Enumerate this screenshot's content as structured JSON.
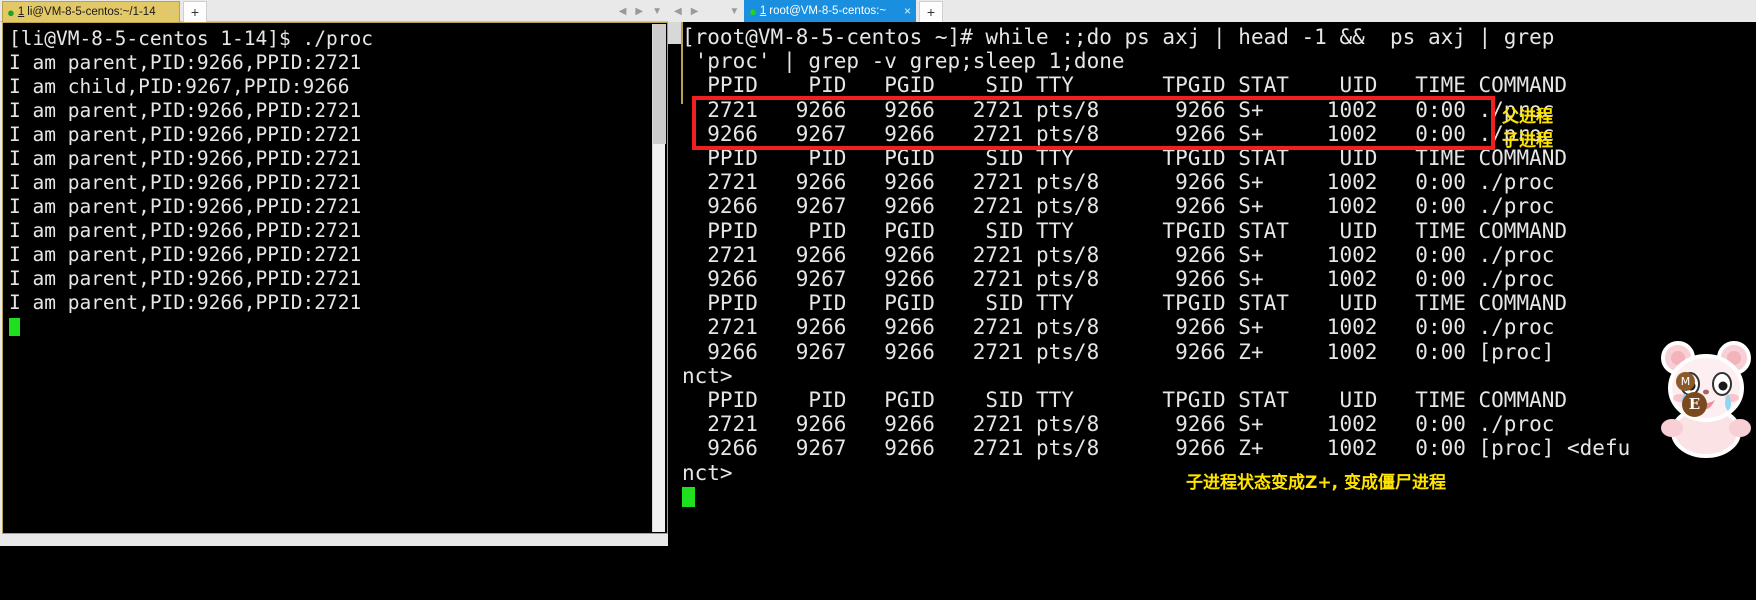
{
  "left_window": {
    "tab": {
      "index": "1",
      "title": "li@VM-8-5-centos:~/1-14",
      "close_label": "×",
      "new_tab_label": "+",
      "status_dot_color": "#21a121"
    },
    "nav": {
      "prev": "◀",
      "next": "▶",
      "menu": "▼"
    },
    "terminal": {
      "lines": [
        "[li@VM-8-5-centos 1-14]$ ./proc",
        "I am parent,PID:9266,PPID:2721",
        "I am child,PID:9267,PPID:9266",
        "I am parent,PID:9266,PPID:2721",
        "I am parent,PID:9266,PPID:2721",
        "I am parent,PID:9266,PPID:2721",
        "I am parent,PID:9266,PPID:2721",
        "I am parent,PID:9266,PPID:2721",
        "I am parent,PID:9266,PPID:2721",
        "I am parent,PID:9266,PPID:2721",
        "I am parent,PID:9266,PPID:2721",
        "I am parent,PID:9266,PPID:2721"
      ]
    }
  },
  "right_window": {
    "tab": {
      "index": "1",
      "title": "root@VM-8-5-centos:~",
      "close_label": "×",
      "new_tab_label": "+",
      "status_dot_color": "#23d423"
    },
    "nav": {
      "prev": "◀",
      "next": "▶",
      "menu": "▼"
    },
    "terminal": {
      "lines": [
        "[root@VM-8-5-centos ~]# while :;do ps axj | head -1 &&  ps axj | grep",
        " 'proc' | grep -v grep;sleep 1;done",
        "  PPID    PID   PGID    SID TTY       TPGID STAT    UID   TIME COMMAND",
        "  2721   9266   9266   2721 pts/8      9266 S+     1002   0:00 ./proc",
        "  9266   9267   9266   2721 pts/8      9266 S+     1002   0:00 ./proc",
        "  PPID    PID   PGID    SID TTY       TPGID STAT    UID   TIME COMMAND",
        "  2721   9266   9266   2721 pts/8      9266 S+     1002   0:00 ./proc",
        "  9266   9267   9266   2721 pts/8      9266 S+     1002   0:00 ./proc",
        "  PPID    PID   PGID    SID TTY       TPGID STAT    UID   TIME COMMAND",
        "  2721   9266   9266   2721 pts/8      9266 S+     1002   0:00 ./proc",
        "  9266   9267   9266   2721 pts/8      9266 S+     1002   0:00 ./proc",
        "  PPID    PID   PGID    SID TTY       TPGID STAT    UID   TIME COMMAND",
        "  2721   9266   9266   2721 pts/8      9266 S+     1002   0:00 ./proc",
        "  9266   9267   9266   2721 pts/8      9266 Z+     1002   0:00 [proc]",
        "nct>",
        "  PPID    PID   PGID    SID TTY       TPGID STAT    UID   TIME COMMAND",
        "  2721   9266   9266   2721 pts/8      9266 S+     1002   0:00 ./proc",
        "  9266   9267   9266   2721 pts/8      9266 Z+     1002   0:00 [proc] <defu",
        "nct>"
      ]
    }
  },
  "annotations": {
    "parent_process": "父进程",
    "child_process": "子进程",
    "zombie_note": "子进程状态变成Z+, 变成僵尸进程",
    "highlight_color": "#f02020",
    "annotation_color": "#ffe400"
  },
  "sticker": {
    "name": "crying-bear-sticker",
    "badge_m": "M",
    "badge_e": "E"
  }
}
